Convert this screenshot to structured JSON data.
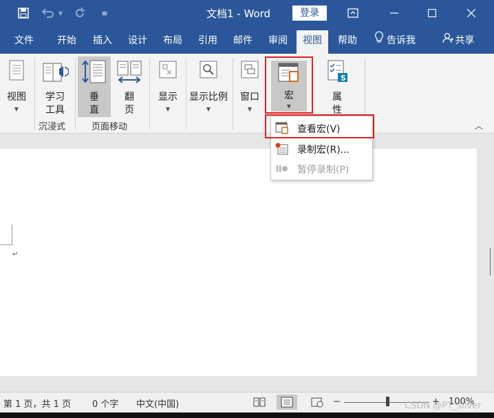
{
  "titlebar": {
    "doc_title": "文档1  -  Word",
    "login_label": "登录"
  },
  "menu": {
    "tabs": [
      "文件",
      "开始",
      "插入",
      "设计",
      "布局",
      "引用",
      "邮件",
      "审阅",
      "视图",
      "帮助"
    ],
    "tell_me": "告诉我",
    "share": "共享"
  },
  "ribbon": {
    "view_button": "视图",
    "learning_tools": [
      "学习",
      "工具"
    ],
    "vertical": [
      "垂",
      "直"
    ],
    "page_flip": [
      "翻",
      "页"
    ],
    "show": "显示",
    "zoom": "显示比例",
    "window": "窗口",
    "macro": "宏",
    "properties": [
      "属",
      "性"
    ],
    "group_immersive": "沉浸式",
    "group_page_move": "页面移动"
  },
  "macro_menu": {
    "items": [
      {
        "label": "查看宏(V)",
        "disabled": false
      },
      {
        "label": "录制宏(R)...",
        "disabled": false
      },
      {
        "label": "暂停录制(P)",
        "disabled": true
      }
    ]
  },
  "document": {
    "paragraph_mark": "↵"
  },
  "status": {
    "page": "第 1 页，共 1 页",
    "words": "0 个字",
    "language": "中文(中国)",
    "zoom": "100%",
    "watermark": "CSDN @PT_silver"
  },
  "colors": {
    "accent": "#2b579a",
    "highlight": "#e02020"
  }
}
